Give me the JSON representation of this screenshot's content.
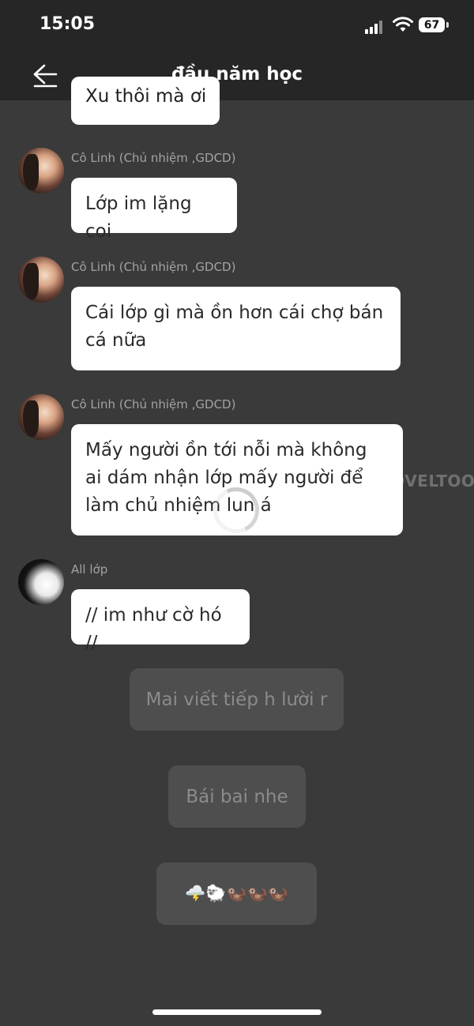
{
  "status_bar": {
    "time": "15:05",
    "battery": "67"
  },
  "header": {
    "title": "đầu năm học"
  },
  "chat": {
    "partial_message": "Xu thôi mà ơi",
    "messages": [
      {
        "sender": "Cô Linh (Chủ nhiệm ,GDCD)",
        "text": "Lớp im lặng coi"
      },
      {
        "sender": "Cô Linh (Chủ nhiệm ,GDCD)",
        "text": "Cái lớp gì mà ồn hơn cái chợ bán cá nữa"
      },
      {
        "sender": "Cô Linh (Chủ nhiệm ,GDCD)",
        "text": "Mấy người ồn tới nỗi mà không ai dám nhận lớp mấy người để làm chủ nhiệm lun á"
      },
      {
        "sender": "All lớp",
        "text": "// im như cờ hó //"
      }
    ],
    "narrations": [
      "Mai viết tiếp h lười r",
      "Bái bai nhe",
      "🌩️🐑🦦🦦🦦"
    ]
  },
  "watermark": "NOVELTOON",
  "colors": {
    "background": "#3a3a3a",
    "header": "#262626",
    "bubble": "#ffffff",
    "narration": "#4e4e4e"
  }
}
